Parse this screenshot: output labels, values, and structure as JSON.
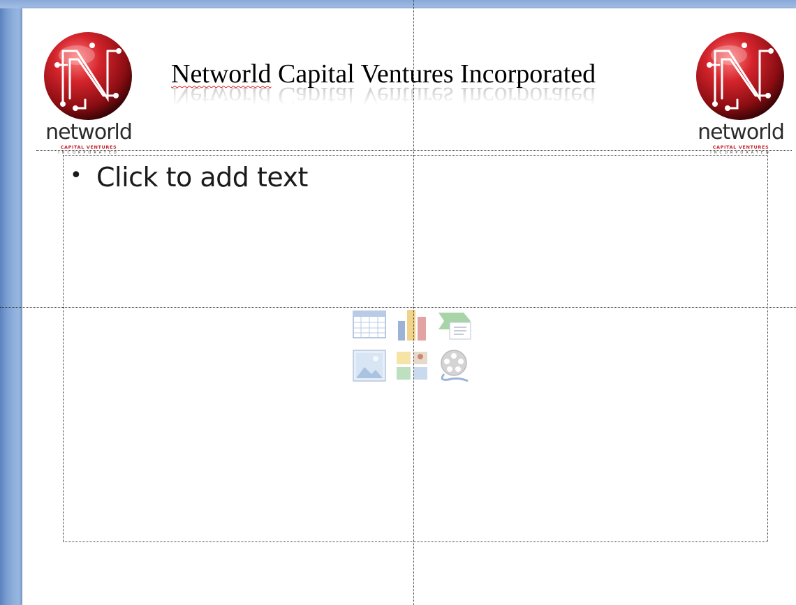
{
  "slide": {
    "title": "Networld Capital Ventures Incorporated",
    "title_misspelled_word": "Networld",
    "title_rest": " Capital Ventures Incorporated",
    "body_placeholder": "Click to add text",
    "bullet": "•"
  },
  "logo": {
    "wordmark": "networld",
    "tagline": "CAPITAL VENTURES",
    "subline": "INCORPORATED",
    "colors": {
      "sphere": "#c01f26",
      "sphere_dark": "#3a0406",
      "wordmark": "#2b2b2b",
      "tagline": "#c8252d"
    }
  },
  "content_icons": [
    {
      "name": "insert-table-icon",
      "label": "Insert Table"
    },
    {
      "name": "insert-chart-icon",
      "label": "Insert Chart"
    },
    {
      "name": "insert-smartart-icon",
      "label": "Insert SmartArt Graphic"
    },
    {
      "name": "insert-picture-icon",
      "label": "Insert Picture from File"
    },
    {
      "name": "insert-clipart-icon",
      "label": "Clip Art"
    },
    {
      "name": "insert-media-icon",
      "label": "Insert Media Clip"
    }
  ],
  "colors": {
    "workspace": "#a9c5ea",
    "slide": "#ffffff",
    "guide": "#333333"
  }
}
